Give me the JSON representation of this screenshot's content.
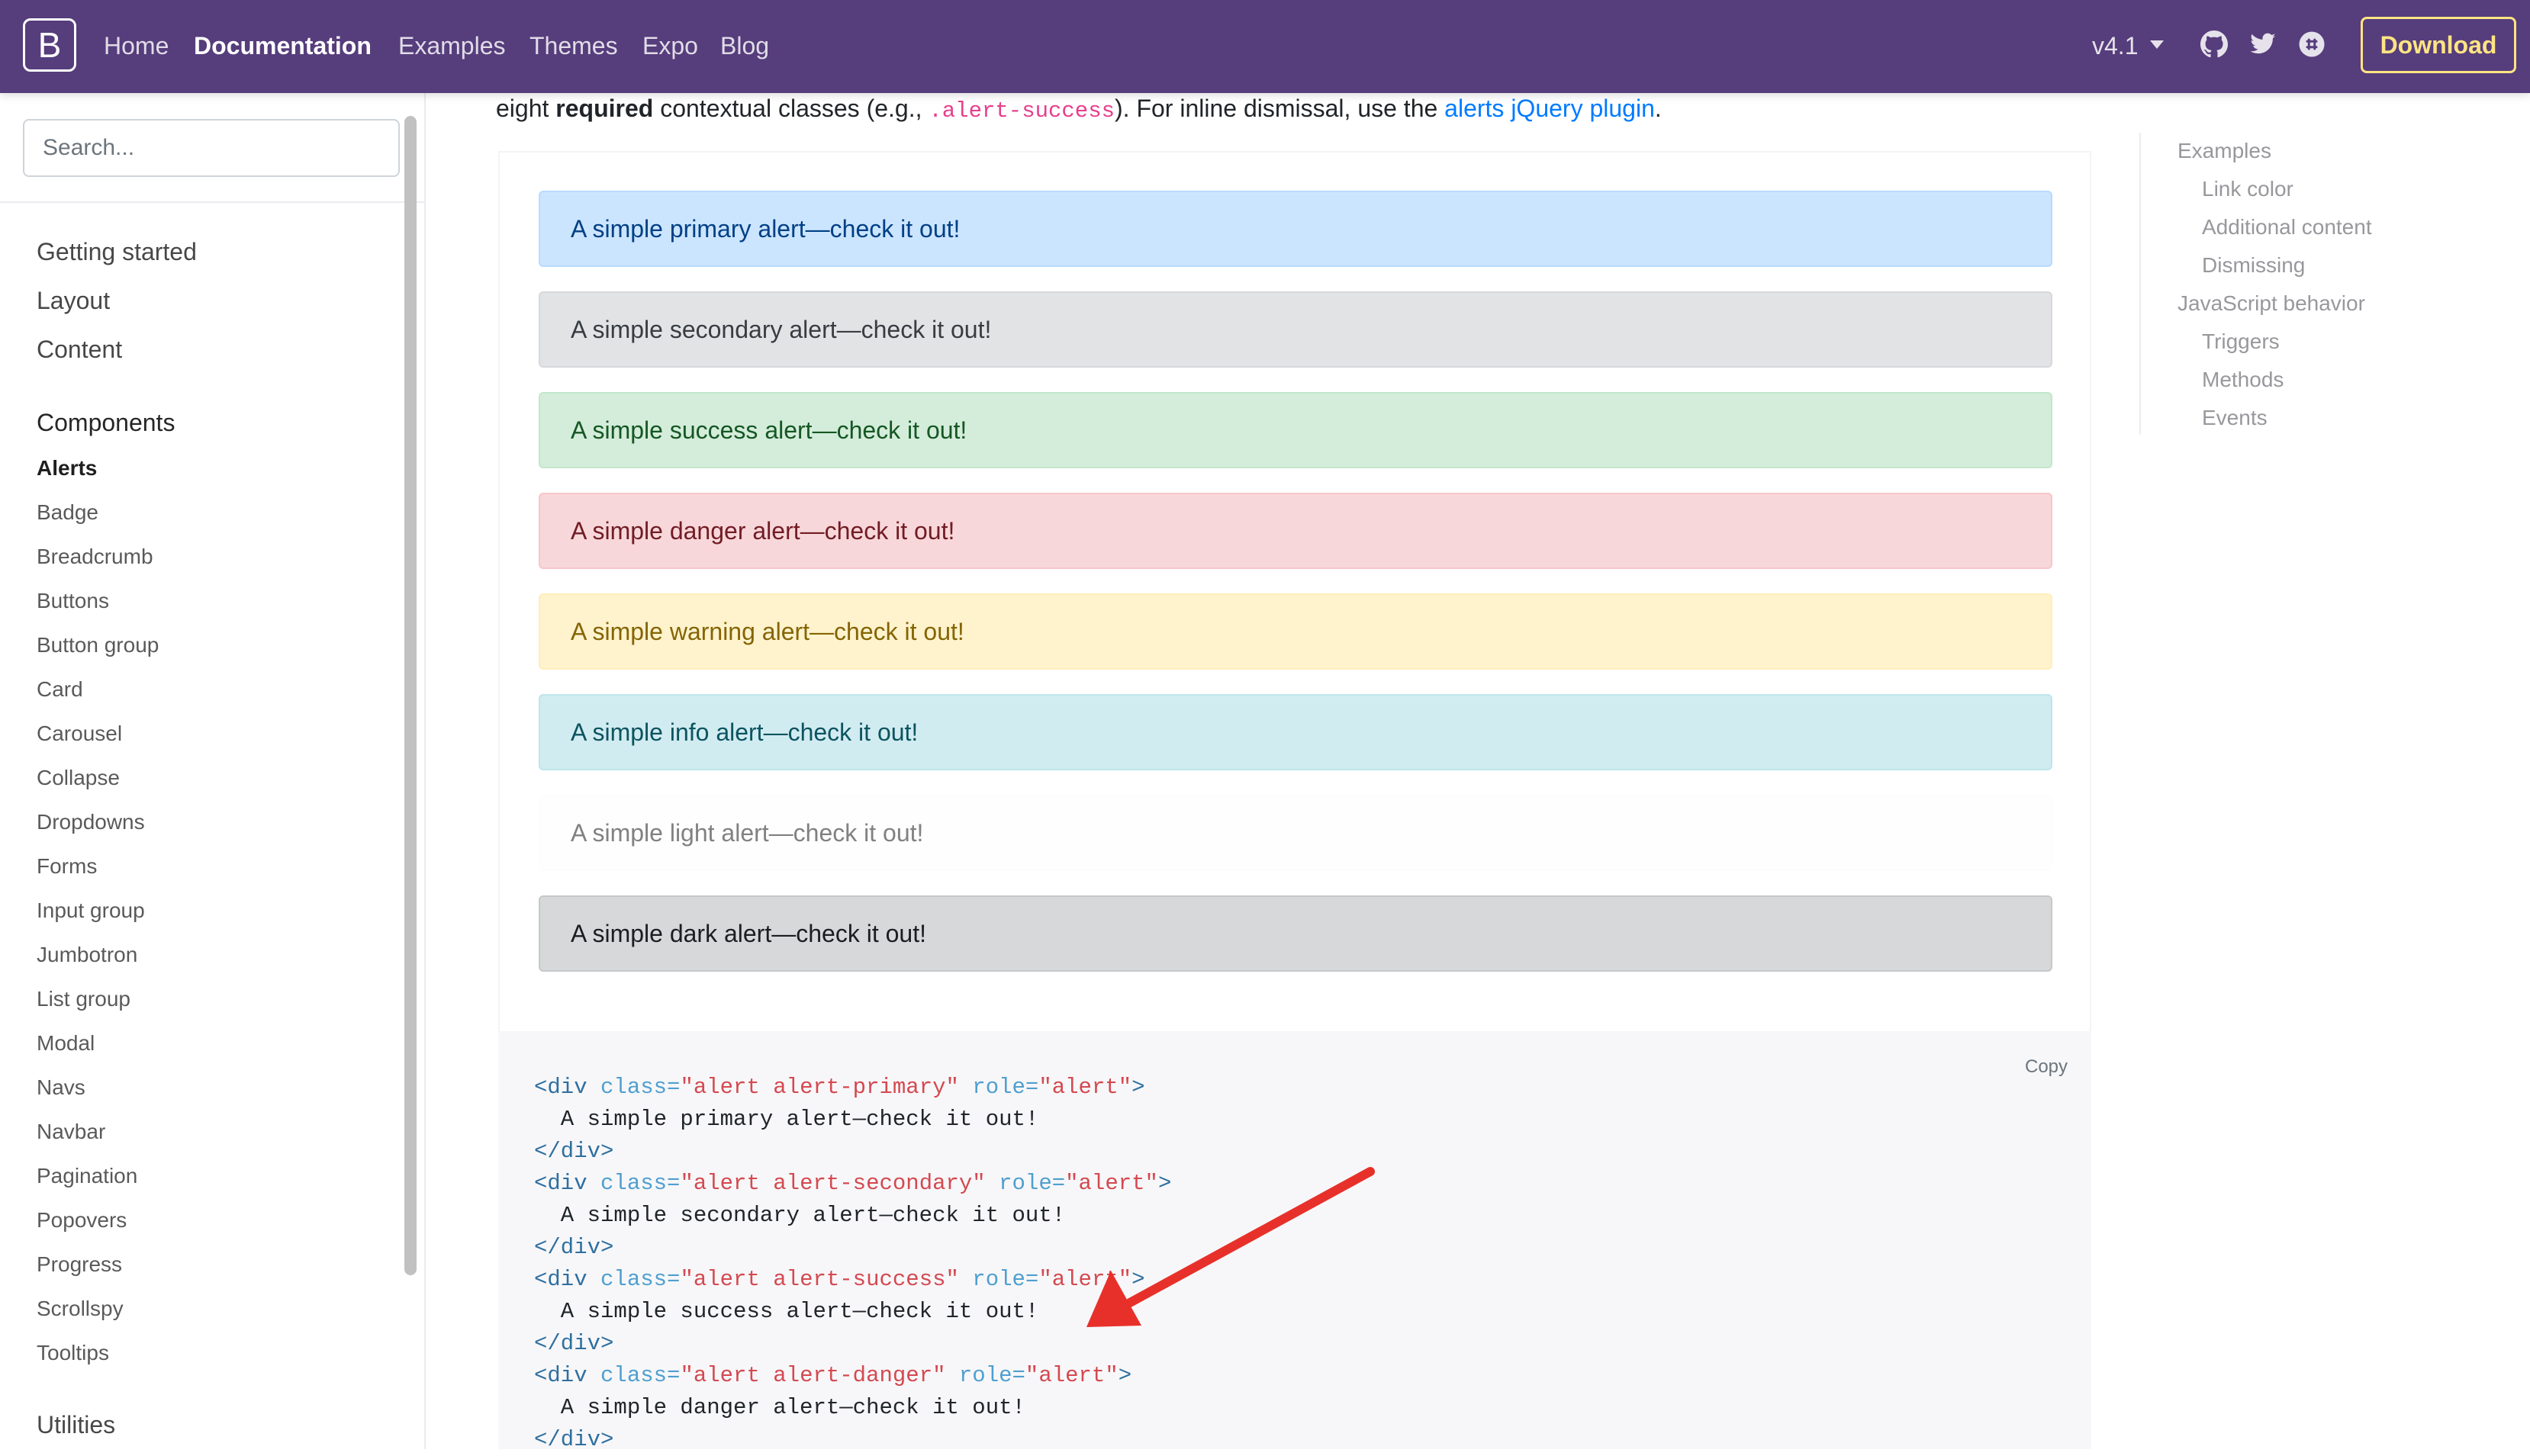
{
  "navbar": {
    "brand": "B",
    "links": [
      "Home",
      "Documentation",
      "Examples",
      "Themes",
      "Expo",
      "Blog"
    ],
    "active_link": "Documentation",
    "version": "v4.1",
    "icons": [
      "github-icon",
      "twitter-icon",
      "slack-icon"
    ],
    "download": "Download",
    "background_color": "#563d7c",
    "download_color": "#ffe484"
  },
  "sidebar": {
    "search_placeholder": "Search...",
    "sections_top": [
      "Getting started",
      "Layout",
      "Content"
    ],
    "components_title": "Components",
    "components": [
      "Alerts",
      "Badge",
      "Breadcrumb",
      "Buttons",
      "Button group",
      "Card",
      "Carousel",
      "Collapse",
      "Dropdowns",
      "Forms",
      "Input group",
      "Jumbotron",
      "List group",
      "Modal",
      "Navs",
      "Navbar",
      "Pagination",
      "Popovers",
      "Progress",
      "Scrollspy",
      "Tooltips"
    ],
    "active_component": "Alerts",
    "utilities_title": "Utilities"
  },
  "intro": {
    "before": "eight ",
    "bold": "required",
    "middle": " contextual classes (e.g., ",
    "code": ".alert-success",
    "after": "). For inline dismissal, use the ",
    "link": "alerts jQuery plugin",
    "end": "."
  },
  "alerts": [
    {
      "text": "A simple primary alert—check it out!",
      "bg": "#cce5ff",
      "border": "#b8daff",
      "color": "#004085"
    },
    {
      "text": "A simple secondary alert—check it out!",
      "bg": "#e2e3e5",
      "border": "#d6d8db",
      "color": "#383d41"
    },
    {
      "text": "A simple success alert—check it out!",
      "bg": "#d4edda",
      "border": "#c3e6cb",
      "color": "#155724"
    },
    {
      "text": "A simple danger alert—check it out!",
      "bg": "#f8d7da",
      "border": "#f5c6cb",
      "color": "#721c24"
    },
    {
      "text": "A simple warning alert—check it out!",
      "bg": "#fff3cd",
      "border": "#ffeeba",
      "color": "#856404"
    },
    {
      "text": "A simple info alert—check it out!",
      "bg": "#d1ecf1",
      "border": "#bee5eb",
      "color": "#0c5460"
    },
    {
      "text": "A simple light alert—check it out!",
      "bg": "#fefefe",
      "border": "#fdfdfe",
      "color": "#818182"
    },
    {
      "text": "A simple dark alert—check it out!",
      "bg": "#d6d8d9",
      "border": "#c6c8ca",
      "color": "#1b1e21"
    }
  ],
  "code": {
    "copy": "Copy",
    "lines": [
      {
        "parts": [
          [
            "t",
            "<div "
          ],
          [
            "a",
            "class="
          ],
          [
            "s",
            "\"alert alert-primary\""
          ],
          [
            "a",
            " role="
          ],
          [
            "s",
            "\"alert\""
          ],
          [
            "t",
            ">"
          ]
        ]
      },
      {
        "parts": [
          [
            "p",
            "  A simple primary alert—check it out!"
          ]
        ]
      },
      {
        "parts": [
          [
            "t",
            "</div>"
          ]
        ]
      },
      {
        "parts": [
          [
            "t",
            "<div "
          ],
          [
            "a",
            "class="
          ],
          [
            "s",
            "\"alert alert-secondary\""
          ],
          [
            "a",
            " role="
          ],
          [
            "s",
            "\"alert\""
          ],
          [
            "t",
            ">"
          ]
        ]
      },
      {
        "parts": [
          [
            "p",
            "  A simple secondary alert—check it out!"
          ]
        ]
      },
      {
        "parts": [
          [
            "t",
            "</div>"
          ]
        ]
      },
      {
        "parts": [
          [
            "t",
            "<div "
          ],
          [
            "a",
            "class="
          ],
          [
            "s",
            "\"alert alert-success\""
          ],
          [
            "a",
            " role="
          ],
          [
            "s",
            "\"alert\""
          ],
          [
            "t",
            ">"
          ]
        ]
      },
      {
        "parts": [
          [
            "p",
            "  A simple success alert—check it out!"
          ]
        ]
      },
      {
        "parts": [
          [
            "t",
            "</div>"
          ]
        ]
      },
      {
        "parts": [
          [
            "t",
            "<div "
          ],
          [
            "a",
            "class="
          ],
          [
            "s",
            "\"alert alert-danger\""
          ],
          [
            "a",
            " role="
          ],
          [
            "s",
            "\"alert\""
          ],
          [
            "t",
            ">"
          ]
        ]
      },
      {
        "parts": [
          [
            "p",
            "  A simple danger alert—check it out!"
          ]
        ]
      },
      {
        "parts": [
          [
            "t",
            "</div>"
          ]
        ]
      }
    ]
  },
  "toc": {
    "items": [
      {
        "label": "Examples",
        "level": 1
      },
      {
        "label": "Link color",
        "level": 2
      },
      {
        "label": "Additional content",
        "level": 2
      },
      {
        "label": "Dismissing",
        "level": 2
      },
      {
        "label": "JavaScript behavior",
        "level": 1
      },
      {
        "label": "Triggers",
        "level": 2
      },
      {
        "label": "Methods",
        "level": 2
      },
      {
        "label": "Events",
        "level": 2
      }
    ]
  },
  "annotation": {
    "type": "red-arrow",
    "color": "#e8302a"
  }
}
